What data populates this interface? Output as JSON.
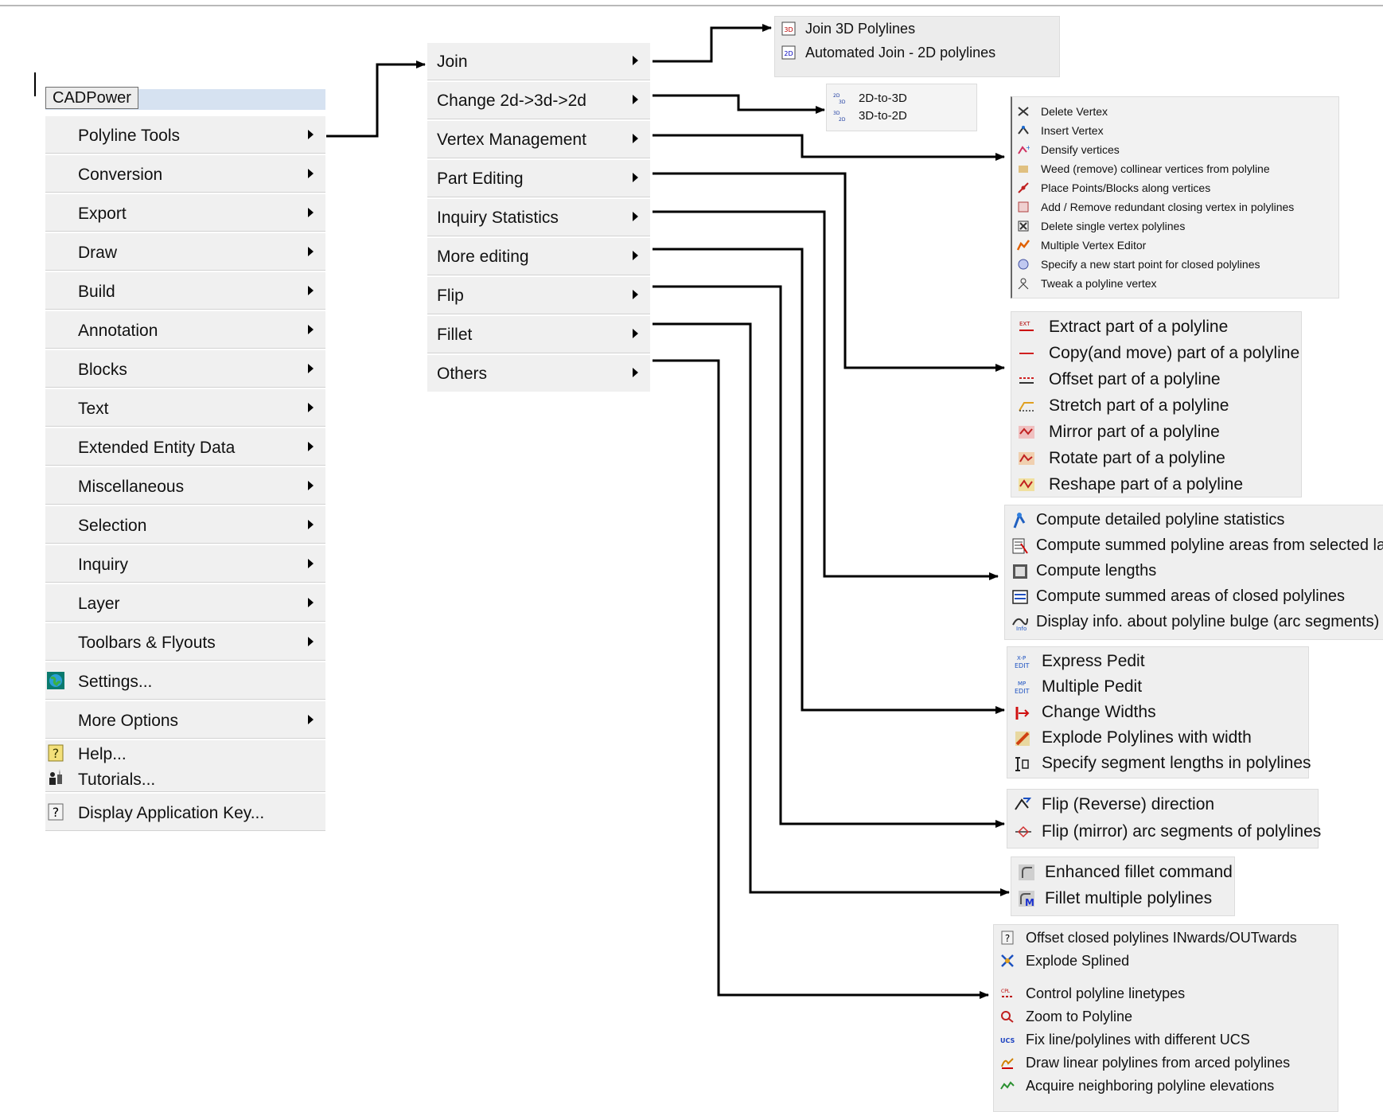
{
  "menubar": {
    "title": "CADPower"
  },
  "main_menu": {
    "items": [
      {
        "label": "Polyline Tools",
        "arrow": true
      },
      {
        "label": "Conversion",
        "arrow": true
      },
      {
        "label": "Export",
        "arrow": true
      },
      {
        "label": "Draw",
        "arrow": true
      },
      {
        "label": "Build",
        "arrow": true
      },
      {
        "label": "Annotation",
        "arrow": true
      },
      {
        "label": "Blocks",
        "arrow": true
      },
      {
        "label": "Text",
        "arrow": true
      },
      {
        "label": "Extended Entity Data",
        "arrow": true
      },
      {
        "label": "Miscellaneous",
        "arrow": true
      },
      {
        "label": "Selection",
        "arrow": true
      },
      {
        "label": "Inquiry",
        "arrow": true
      },
      {
        "label": "Layer",
        "arrow": true
      },
      {
        "label": "Toolbars & Flyouts",
        "arrow": true
      },
      {
        "label": "Settings...",
        "icon": "globe-settings-icon"
      },
      {
        "label": "More Options",
        "arrow": true
      },
      {
        "label": "Help...",
        "icon": "help-question-icon"
      },
      {
        "label": "Tutorials...",
        "icon": "tutorials-icon"
      },
      {
        "label": "Display Application Key...",
        "icon": "key-question-icon"
      }
    ]
  },
  "polyline_tools_menu": {
    "items": [
      {
        "label": "Join"
      },
      {
        "label": "Change 2d->3d->2d"
      },
      {
        "label": "Vertex Management"
      },
      {
        "label": "Part Editing"
      },
      {
        "label": "Inquiry  Statistics"
      },
      {
        "label": "More editing"
      },
      {
        "label": "Flip"
      },
      {
        "label": "Fillet"
      },
      {
        "label": "Others"
      }
    ]
  },
  "join_submenu": {
    "items": [
      "Join 3D Polylines",
      "Automated Join - 2D polylines"
    ]
  },
  "change_submenu": {
    "items": [
      "2D-to-3D",
      "3D-to-2D"
    ]
  },
  "vertex_submenu": {
    "items": [
      "Delete Vertex",
      "Insert Vertex",
      "Densify vertices",
      "Weed (remove) collinear vertices from polyline",
      "Place Points/Blocks along vertices",
      "Add / Remove redundant closing vertex in polylines",
      "Delete single vertex polylines",
      "Multiple Vertex Editor",
      "Specify a new start point for closed polylines",
      "Tweak a polyline vertex"
    ]
  },
  "part_editing_submenu": {
    "items": [
      "Extract part of a polyline",
      "Copy(and move) part of a polyline",
      "Offset part of a polyline",
      "Stretch part of a polyline",
      "Mirror part of a polyline",
      "Rotate part of a polyline",
      "Reshape part of a polyline"
    ]
  },
  "inquiry_submenu": {
    "items": [
      "Compute detailed polyline statistics",
      "Compute summed polyline areas from selected layers",
      "Compute lengths",
      "Compute summed areas of closed polylines",
      "Display info. about polyline bulge (arc segments)"
    ]
  },
  "more_editing_submenu": {
    "items": [
      "Express Pedit",
      "Multiple Pedit",
      "Change Widths",
      "Explode Polylines with width",
      "Specify segment lengths in polylines"
    ]
  },
  "flip_submenu": {
    "items": [
      "Flip (Reverse) direction",
      "Flip (mirror) arc segments of polylines"
    ]
  },
  "fillet_submenu": {
    "items": [
      "Enhanced fillet command",
      "Fillet multiple polylines"
    ]
  },
  "others_submenu": {
    "group1": [
      "Offset closed polylines INwards/OUTwards",
      "Explode Splined"
    ],
    "group2": [
      "Control polyline linetypes",
      "Zoom to Polyline",
      "Fix line/polylines with different UCS",
      "Draw linear polylines from arced polylines",
      "Acquire neighboring polyline elevations"
    ]
  },
  "colors": {
    "menu_bg": "#f0f0f0",
    "connector": "#000000",
    "menubar_highlight": "#d6e2f1"
  }
}
